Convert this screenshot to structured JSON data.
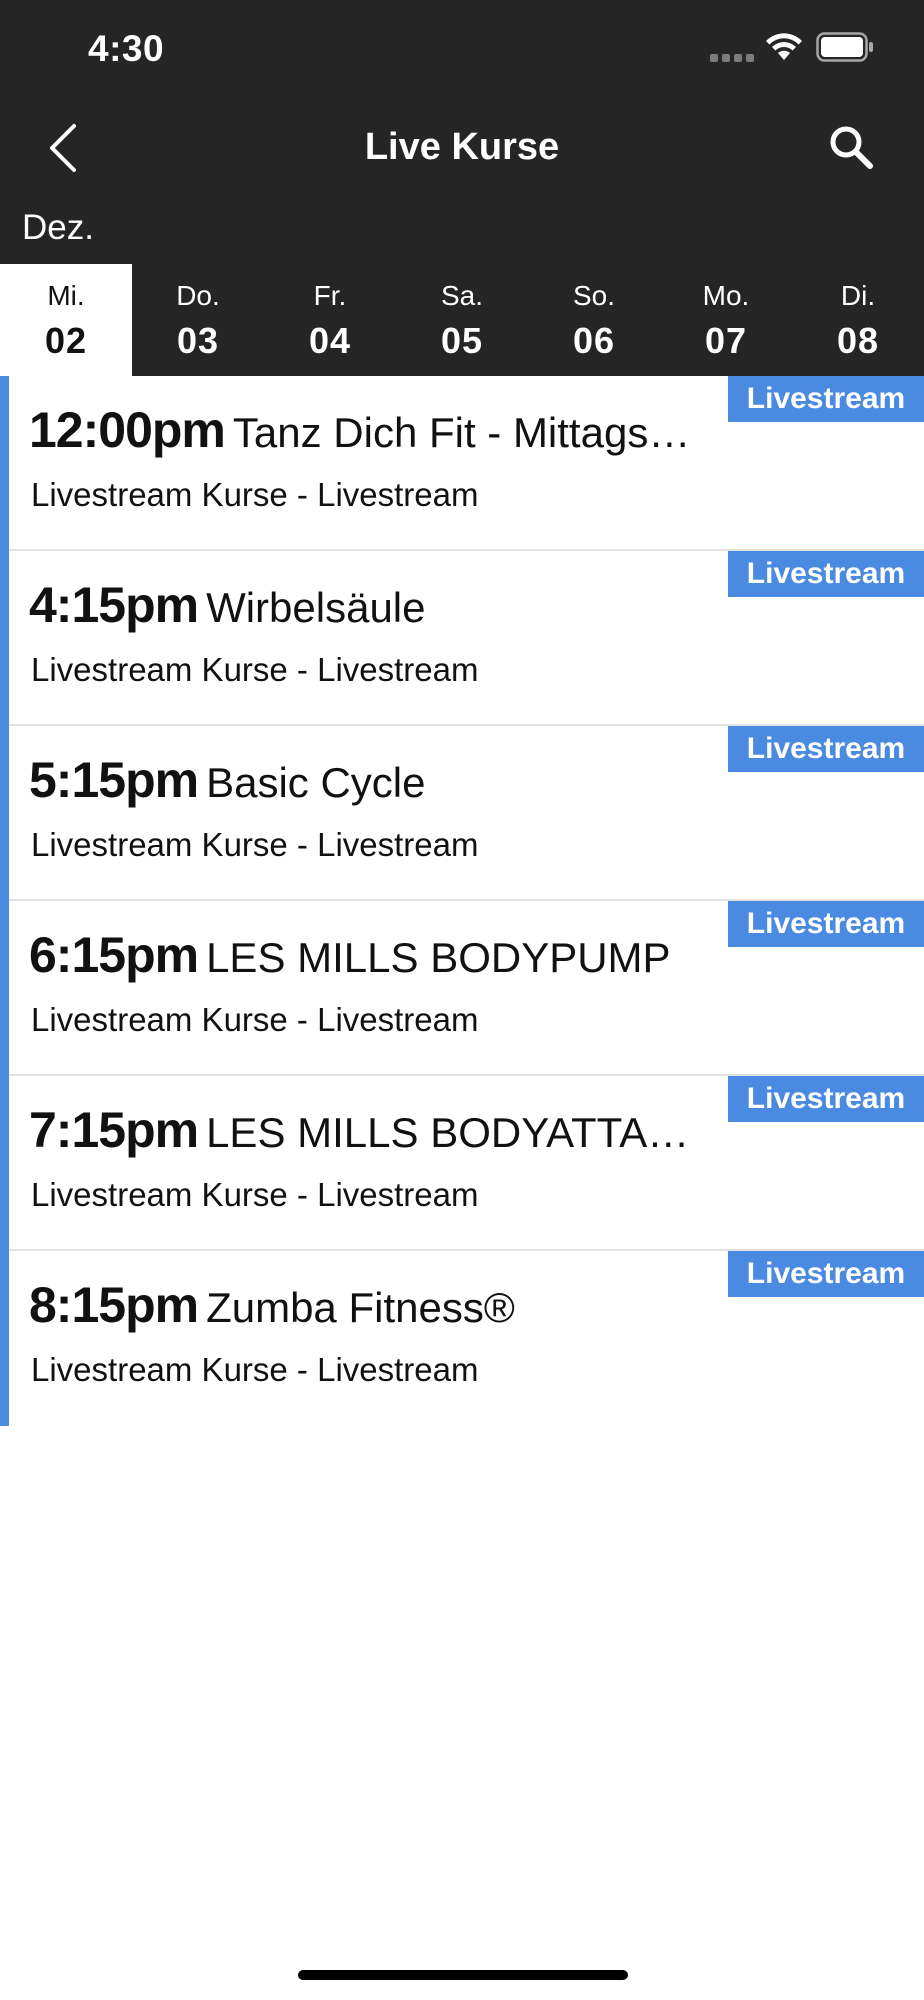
{
  "status_bar": {
    "time": "4:30"
  },
  "nav": {
    "title": "Live Kurse",
    "back_icon": "chevron-left-icon",
    "search_icon": "search-icon"
  },
  "month": "Dez.",
  "days": [
    {
      "weekday": "Mi.",
      "date": "02",
      "selected": true
    },
    {
      "weekday": "Do.",
      "date": "03",
      "selected": false
    },
    {
      "weekday": "Fr.",
      "date": "04",
      "selected": false
    },
    {
      "weekday": "Sa.",
      "date": "05",
      "selected": false
    },
    {
      "weekday": "So.",
      "date": "06",
      "selected": false
    },
    {
      "weekday": "Mo.",
      "date": "07",
      "selected": false
    },
    {
      "weekday": "Di.",
      "date": "08",
      "selected": false
    }
  ],
  "classes": [
    {
      "time": "12:00pm",
      "name": "Tanz Dich Fit - Mittagspause",
      "subtitle": "Livestream Kurse - Livestream",
      "badge": "Livestream"
    },
    {
      "time": "4:15pm",
      "name": "Wirbelsäule",
      "subtitle": "Livestream Kurse - Livestream",
      "badge": "Livestream"
    },
    {
      "time": "5:15pm",
      "name": "Basic Cycle",
      "subtitle": "Livestream Kurse - Livestream",
      "badge": "Livestream"
    },
    {
      "time": "6:15pm",
      "name": "LES MILLS BODYPUMP",
      "subtitle": "Livestream Kurse - Livestream",
      "badge": "Livestream"
    },
    {
      "time": "7:15pm",
      "name": "LES MILLS BODYATTACK",
      "subtitle": "Livestream Kurse - Livestream",
      "badge": "Livestream"
    },
    {
      "time": "8:15pm",
      "name": "Zumba Fitness®",
      "subtitle": "Livestream Kurse - Livestream",
      "badge": "Livestream"
    }
  ],
  "colors": {
    "header_bg": "#252525",
    "accent": "#4a8ae0",
    "divider": "#e2e2e2"
  }
}
